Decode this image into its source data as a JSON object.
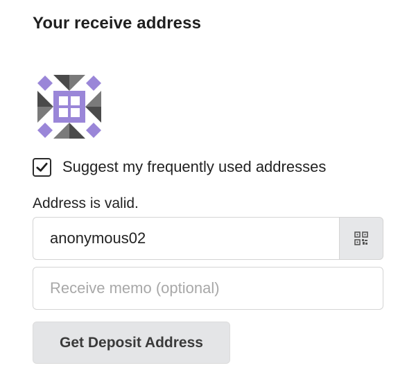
{
  "section": {
    "title": "Your receive address"
  },
  "identicon": {
    "icon": "identicon-avatar",
    "colors": {
      "accent": "#9a86d8",
      "dark": "#4a4a4a",
      "light": "#ffffff"
    }
  },
  "suggest": {
    "label": "Suggest my frequently used addresses",
    "checked": true
  },
  "address": {
    "status": "Address is valid.",
    "value": "anonymous02",
    "qr_icon": "qr-code-icon"
  },
  "memo": {
    "value": "",
    "placeholder": "Receive memo (optional)"
  },
  "actions": {
    "deposit_label": "Get Deposit Address"
  }
}
